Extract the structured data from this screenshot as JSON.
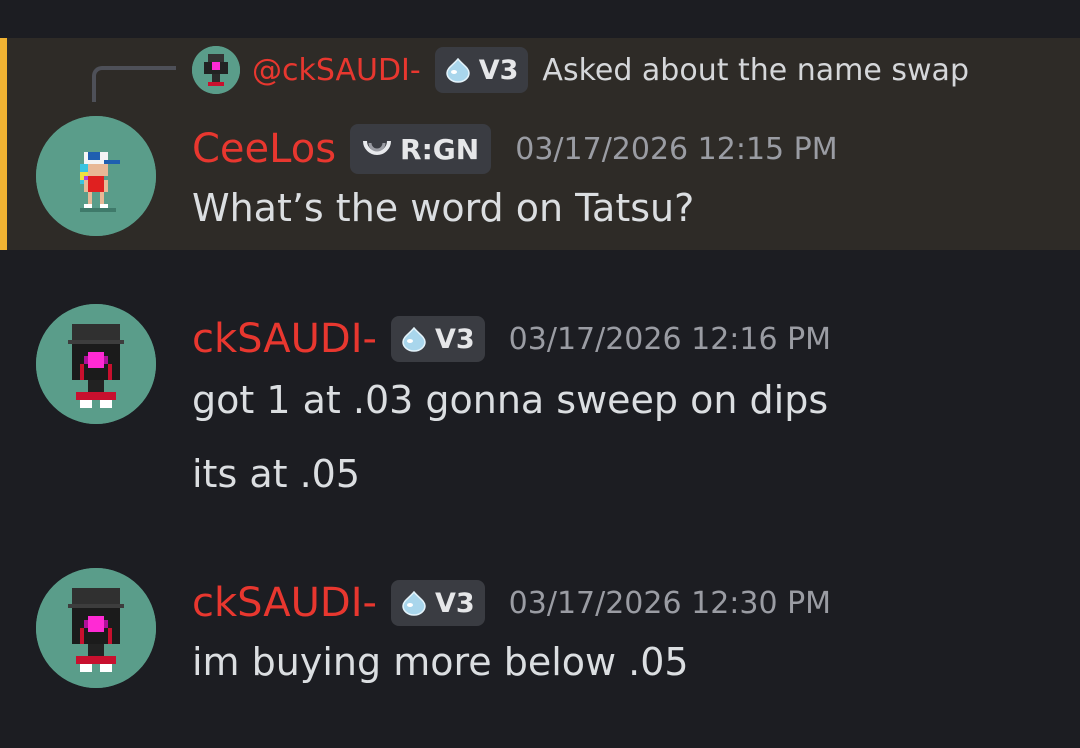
{
  "reply_reference": {
    "username": "@ckSAUDI-",
    "tag": "V3",
    "text": "Asked about the name swap"
  },
  "messages": [
    {
      "author": "CeeLos",
      "tag": "R:GN",
      "timestamp": "03/17/2026 12:15 PM",
      "lines": [
        "What’s the word on Tatsu?"
      ],
      "highlighted": true
    },
    {
      "author": "ckSAUDI-",
      "tag": "V3",
      "timestamp": "03/17/2026 12:16 PM",
      "lines": [
        "got 1 at .03 gonna sweep on dips",
        "its at .05"
      ]
    },
    {
      "author": "ckSAUDI-",
      "tag": "V3",
      "timestamp": "03/17/2026 12:30 PM",
      "lines": [
        "im buying more below .05"
      ]
    }
  ],
  "icons": {
    "v3_tag_icon": "water-drop-icon",
    "rgn_tag_icon": "moon-ring-icon"
  },
  "colors": {
    "background": "#1c1d22",
    "highlight_background": "#2e2b27",
    "highlight_bar": "#f0b232",
    "username": "#e8372f",
    "avatar_background": "#5a9d8a"
  }
}
